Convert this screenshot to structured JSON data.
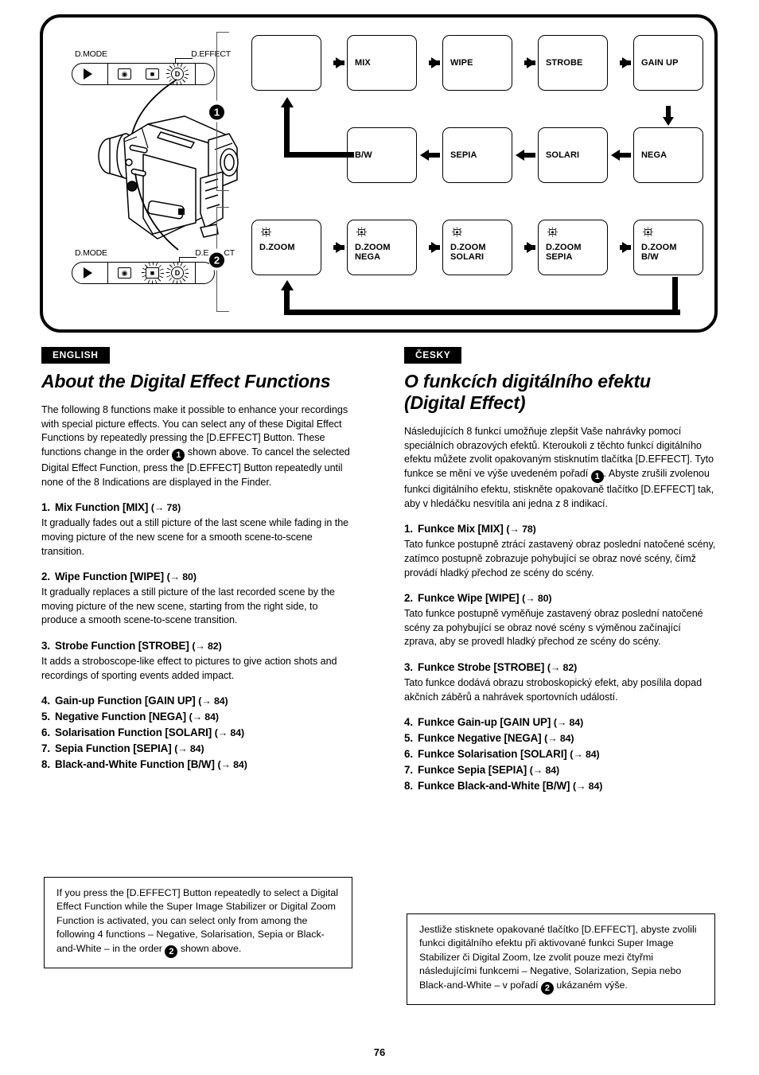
{
  "page": {
    "number": "76"
  },
  "diagram": {
    "control_panels": [
      {
        "id": "panel-1",
        "left_label": "D.MODE",
        "right_label": "D.EFFECT",
        "icons": [
          "play-icon",
          "image-stabilizer-icon",
          "digital-zoom-icon",
          "digital-effect-icon"
        ],
        "blinking": [
          "digital-effect-icon"
        ]
      },
      {
        "id": "panel-2",
        "left_label": "D.MODE",
        "right_label": "D.EFFECT",
        "icons": [
          "play-icon",
          "image-stabilizer-icon",
          "digital-zoom-icon",
          "digital-effect-icon"
        ],
        "blinking": [
          "digital-zoom-icon",
          "digital-effect-icon"
        ]
      }
    ],
    "sequence_markers": [
      "1",
      "2"
    ],
    "flow_row_1": [
      "",
      "MIX",
      "WIPE",
      "STROBE",
      "GAIN UP"
    ],
    "flow_row_2": [
      "B/W",
      "SEPIA",
      "SOLARI",
      "NEGA"
    ],
    "flow_row_3": [
      {
        "line1": "D.ZOOM",
        "line2": ""
      },
      {
        "line1": "D.ZOOM",
        "line2": "NEGA"
      },
      {
        "line1": "D.ZOOM",
        "line2": "SOLARI"
      },
      {
        "line1": "D.ZOOM",
        "line2": "SEPIA"
      },
      {
        "line1": "D.ZOOM",
        "line2": "B/W"
      }
    ]
  },
  "english": {
    "badge": "ENGLISH",
    "title": "About the Digital Effect Functions",
    "intro_a": "The following 8 functions make it possible to enhance your recordings with special picture effects. You can select any of these Digital Effect Functions by repeatedly pressing the [D.EFFECT] Button. These functions change in the order ",
    "intro_b": " shown above. To cancel the selected Digital Effect Function, press the [D.EFFECT] Button repeatedly until none of the 8 Indications are displayed in the Finder.",
    "items": [
      {
        "num": "1.",
        "heading": "Mix Function [MIX]",
        "page_ref": "(→ 78)",
        "body": "It gradually fades out a still picture of the last scene while fading in the moving picture of the new scene for a smooth scene-to-scene transition."
      },
      {
        "num": "2.",
        "heading": "Wipe Function [WIPE]",
        "page_ref": "(→ 80)",
        "body": "It gradually replaces a still picture of the last recorded scene by the moving picture of the new scene, starting from the right side, to produce a smooth scene-to-scene transition."
      },
      {
        "num": "3.",
        "heading": "Strobe Function [STROBE]",
        "page_ref": "(→ 82)",
        "body": "It adds a stroboscope-like effect to pictures to give action shots and recordings of sporting events added impact."
      },
      {
        "num": "4.",
        "heading": "Gain-up Function [GAIN UP]",
        "page_ref": "(→ 84)",
        "body": ""
      },
      {
        "num": "5.",
        "heading": "Negative Function [NEGA]",
        "page_ref": "(→ 84)",
        "body": ""
      },
      {
        "num": "6.",
        "heading": "Solarisation Function [SOLARI]",
        "page_ref": "(→ 84)",
        "body": ""
      },
      {
        "num": "7.",
        "heading": "Sepia Function [SEPIA]",
        "page_ref": "(→ 84)",
        "body": ""
      },
      {
        "num": "8.",
        "heading": "Black-and-White Function [B/W]",
        "page_ref": "(→ 84)",
        "body": ""
      }
    ],
    "note_a": "If you press the [D.EFFECT] Button repeatedly to select a Digital Effect Function while the Super Image Stabilizer or Digital Zoom Function is activated, you can select only from among the following 4 functions – Negative, Solarisation, Sepia or Black-and-White – in the order ",
    "note_b": " shown above."
  },
  "czech": {
    "badge": "ČESKY",
    "title": "O funkcích digitálního efektu (Digital Effect)",
    "intro_a": "Následujících 8 funkcí umožňuje zlepšit Vaše nahrávky pomocí speciálních obrazových efektů. Kteroukoli z těchto funkcí digitálního efektu můžete zvolit opakovaným stisknutím tlačítka [D.EFFECT]. Tyto funkce se mění ve výše uvedeném pořadí ",
    "intro_b": ". Abyste zrušili zvolenou funkci digitálního efektu, stiskněte opakovaně tlačítko [D.EFFECT] tak, aby v hledáčku nesvítila ani jedna z 8 indikací.",
    "items": [
      {
        "num": "1.",
        "heading": "Funkce Mix [MIX]",
        "page_ref": "(→ 78)",
        "body": "Tato funkce postupně ztrácí zastavený obraz poslední natočené scény, zatímco postupně zobrazuje pohybující se obraz nové scény, čímž provádí hladký přechod ze scény do scény."
      },
      {
        "num": "2.",
        "heading": "Funkce Wipe [WIPE]",
        "page_ref": "(→ 80)",
        "body": "Tato funkce postupně vyměňuje zastavený obraz poslední natočené scény za pohybující se obraz nové scény s výměnou začínající zprava, aby se provedl hladký přechod ze scény do scény."
      },
      {
        "num": "3.",
        "heading": "Funkce Strobe [STROBE]",
        "page_ref": "(→ 82)",
        "body": "Tato funkce dodává obrazu stroboskopický efekt, aby posílila dopad akčních záběrů a nahrávek sportovních událostí."
      },
      {
        "num": "4.",
        "heading": "Funkce Gain-up [GAIN UP]",
        "page_ref": "(→ 84)",
        "body": ""
      },
      {
        "num": "5.",
        "heading": "Funkce Negative [NEGA]",
        "page_ref": "(→ 84)",
        "body": ""
      },
      {
        "num": "6.",
        "heading": "Funkce Solarisation [SOLARI]",
        "page_ref": "(→ 84)",
        "body": ""
      },
      {
        "num": "7.",
        "heading": "Funkce Sepia [SEPIA]",
        "page_ref": "(→ 84)",
        "body": ""
      },
      {
        "num": "8.",
        "heading": "Funkce Black-and-White [B/W]",
        "page_ref": "(→ 84)",
        "body": ""
      }
    ],
    "note_a": "Jestliže stisknete opakované tlačítko [D.EFFECT], abyste zvolili funkci digitálního efektu při aktivované funkci Super Image Stabilizer či Digital Zoom, lze zvolit pouze mezi čtyřmi následujícími funkcemi – Negative, Solarization, Sepia nebo Black-and-White – v pořadí ",
    "note_b": " ukázaném výše."
  }
}
